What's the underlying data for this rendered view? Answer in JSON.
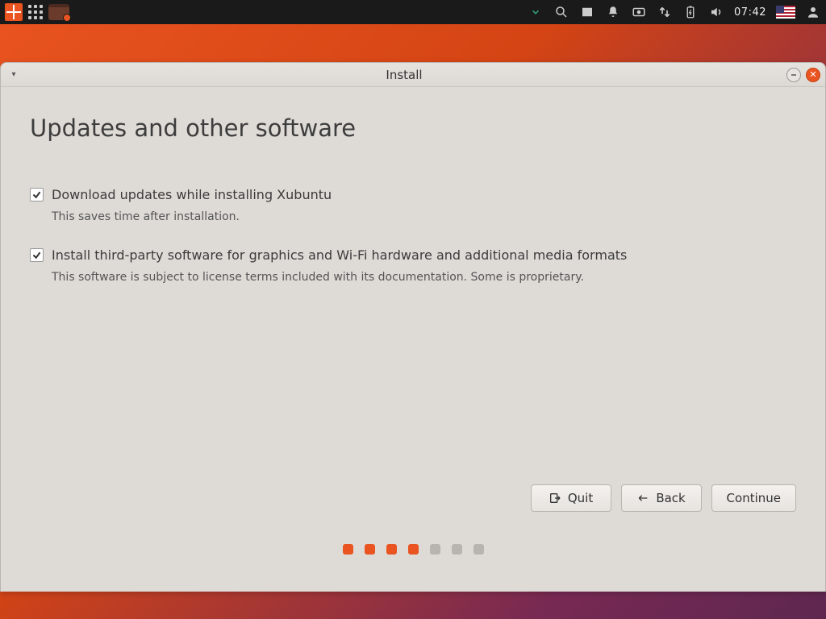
{
  "panel": {
    "clock": "07:42"
  },
  "window": {
    "title": "Install"
  },
  "page": {
    "heading": "Updates and other software"
  },
  "options": {
    "updates": {
      "label": "Download updates while installing Xubuntu",
      "description": "This saves time after installation.",
      "checked": true
    },
    "thirdparty": {
      "label": "Install third-party software for graphics and Wi-Fi hardware and additional media formats",
      "description": "This software is subject to license terms included with its documentation. Some is proprietary.",
      "checked": true
    }
  },
  "buttons": {
    "quit": "Quit",
    "back": "Back",
    "continue": "Continue"
  },
  "progress": {
    "total": 7,
    "current": 4
  }
}
